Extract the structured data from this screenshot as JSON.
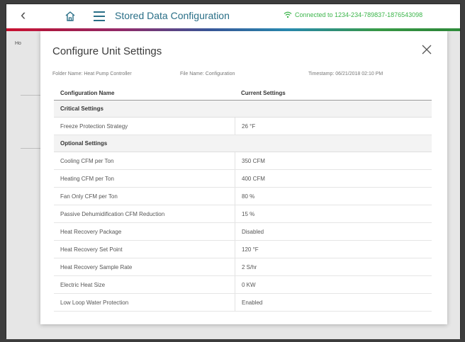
{
  "topbar": {
    "title": "Stored Data Configuration",
    "connection": "Connected to 1234-234-789837-1876543098"
  },
  "background": {
    "tag": "Ho"
  },
  "modal": {
    "title": "Configure Unit Settings",
    "folder": "Folder Name: Heat Pump Controller",
    "file": "File Name: Configuration",
    "timestamp": "Timestamp: 06/21/2018 02:10 PM",
    "columns": {
      "name": "Configuration Name",
      "value": "Current Settings"
    },
    "sections": [
      {
        "title": "Critical Settings",
        "rows": [
          {
            "name": "Freeze Protection Strategy",
            "value": "26 °F"
          }
        ]
      },
      {
        "title": "Optional Settings",
        "rows": [
          {
            "name": "Cooling CFM per Ton",
            "value": "350 CFM"
          },
          {
            "name": "Heating CFM per Ton",
            "value": "400 CFM"
          },
          {
            "name": "Fan Only CFM per Ton",
            "value": "80 %"
          },
          {
            "name": "Passive Dehumidification CFM Reduction",
            "value": "15 %"
          },
          {
            "name": "Heat Recovery Package",
            "value": "Disabled"
          },
          {
            "name": "Heat Recovery Set Point",
            "value": "120 °F"
          },
          {
            "name": "Heat Recovery Sample Rate",
            "value": "2 S/hr"
          },
          {
            "name": "Electric Heat Size",
            "value": "0 KW"
          },
          {
            "name": "Low Loop Water Protection",
            "value": "Enabled"
          }
        ]
      }
    ]
  },
  "colors": {
    "accent": "#2a6f87",
    "connected": "#3bb54a"
  }
}
